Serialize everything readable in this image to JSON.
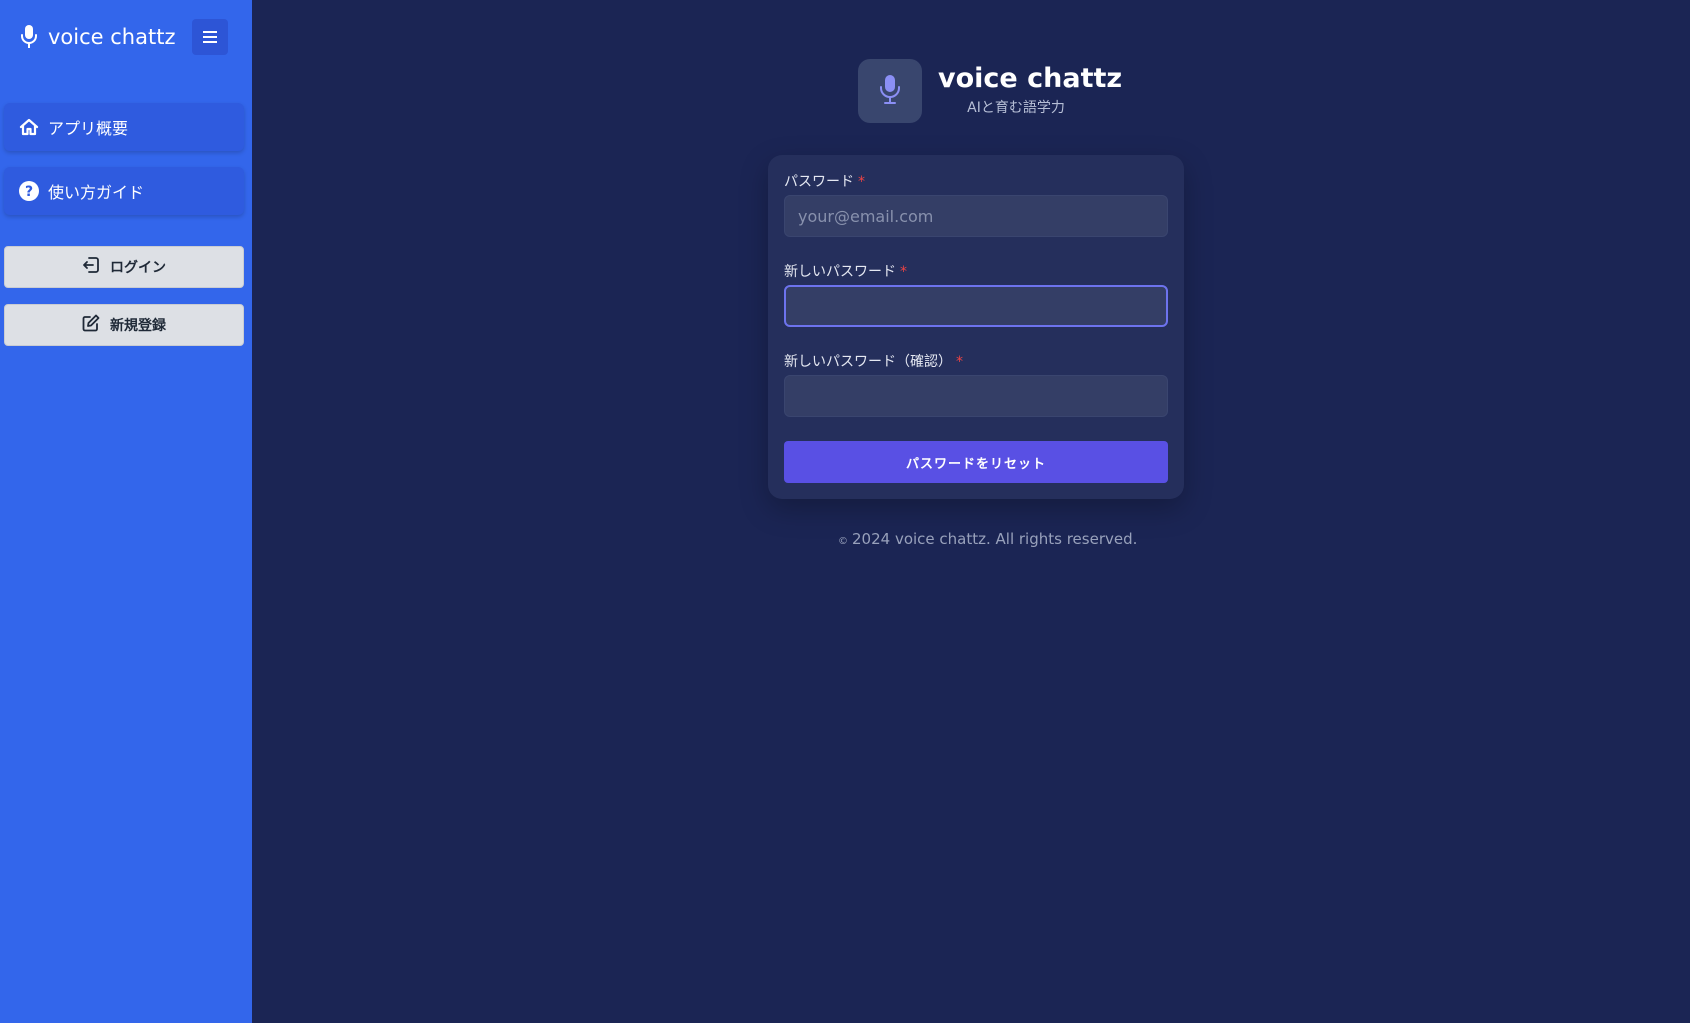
{
  "sidebar": {
    "brand": {
      "name": "voice chattz",
      "icon": "microphone-icon"
    },
    "menu_toggle_icon": "hamburger-icon",
    "nav": [
      {
        "label": "アプリ概要",
        "icon": "home-icon"
      },
      {
        "label": "使い方ガイド",
        "icon": "question-circle-icon"
      }
    ],
    "buttons": {
      "login": {
        "label": "ログイン",
        "icon": "login-icon"
      },
      "register": {
        "label": "新規登録",
        "icon": "edit-icon"
      }
    }
  },
  "header": {
    "title": "voice chattz",
    "subtitle": "AIと育む語学力",
    "logo_icon": "microphone-icon"
  },
  "form": {
    "fields": [
      {
        "label": "パスワード",
        "required_mark": "*",
        "placeholder": "your@email.com",
        "value": ""
      },
      {
        "label": "新しいパスワード",
        "required_mark": "*",
        "placeholder": "",
        "value": ""
      },
      {
        "label": "新しいパスワード（確認）",
        "required_mark": "*",
        "placeholder": "",
        "value": ""
      }
    ],
    "submit_label": "パスワードをリセット"
  },
  "footer": {
    "copyright_symbol": "©",
    "text": "2024 voice chattz. All rights reserved."
  },
  "colors": {
    "sidebar": "#3366eb",
    "background": "#1b2554",
    "card": "#252f5c",
    "primary_button": "#5950e4",
    "focus_border": "#6d73ee",
    "required": "#ef4444"
  }
}
